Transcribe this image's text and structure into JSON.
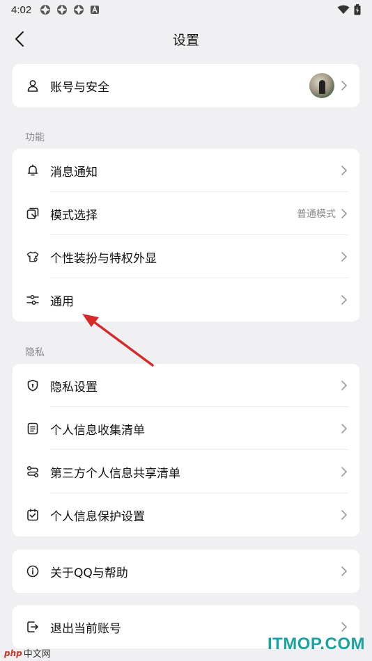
{
  "status_bar": {
    "time": "4:02",
    "icons": [
      "app-notification-icon",
      "app-notification-icon",
      "app-notification-icon",
      "a-badge-icon"
    ],
    "right_icons": [
      "wifi-icon",
      "battery-icon"
    ]
  },
  "header": {
    "title": "设置",
    "back_icon": "back-arrow-icon"
  },
  "account": {
    "label": "账号与安全",
    "icon": "person-icon"
  },
  "features": {
    "section_label": "功能",
    "items": [
      {
        "label": "消息通知",
        "icon": "bell-icon",
        "value": ""
      },
      {
        "label": "模式选择",
        "icon": "mode-icon",
        "value": "普通模式"
      },
      {
        "label": "个性装扮与特权外显",
        "icon": "shirt-icon",
        "value": ""
      },
      {
        "label": "通用",
        "icon": "sliders-icon",
        "value": ""
      }
    ]
  },
  "privacy": {
    "section_label": "隐私",
    "items": [
      {
        "label": "隐私设置",
        "icon": "shield-icon"
      },
      {
        "label": "个人信息收集清单",
        "icon": "document-icon"
      },
      {
        "label": "第三方个人信息共享清单",
        "icon": "share-icon"
      },
      {
        "label": "个人信息保护设置",
        "icon": "check-box-icon"
      }
    ]
  },
  "about": {
    "label": "关于QQ与帮助",
    "icon": "info-icon"
  },
  "logout": {
    "label": "退出当前账号",
    "icon": "logout-icon"
  },
  "watermarks": {
    "left_php": "php",
    "left_text": "中文网",
    "right_text": "ITMOP.COM"
  },
  "colors": {
    "background": "#f0f0f2",
    "card": "#ffffff",
    "annotation_arrow": "#d42a2a",
    "watermark": "#1aa3a3"
  }
}
